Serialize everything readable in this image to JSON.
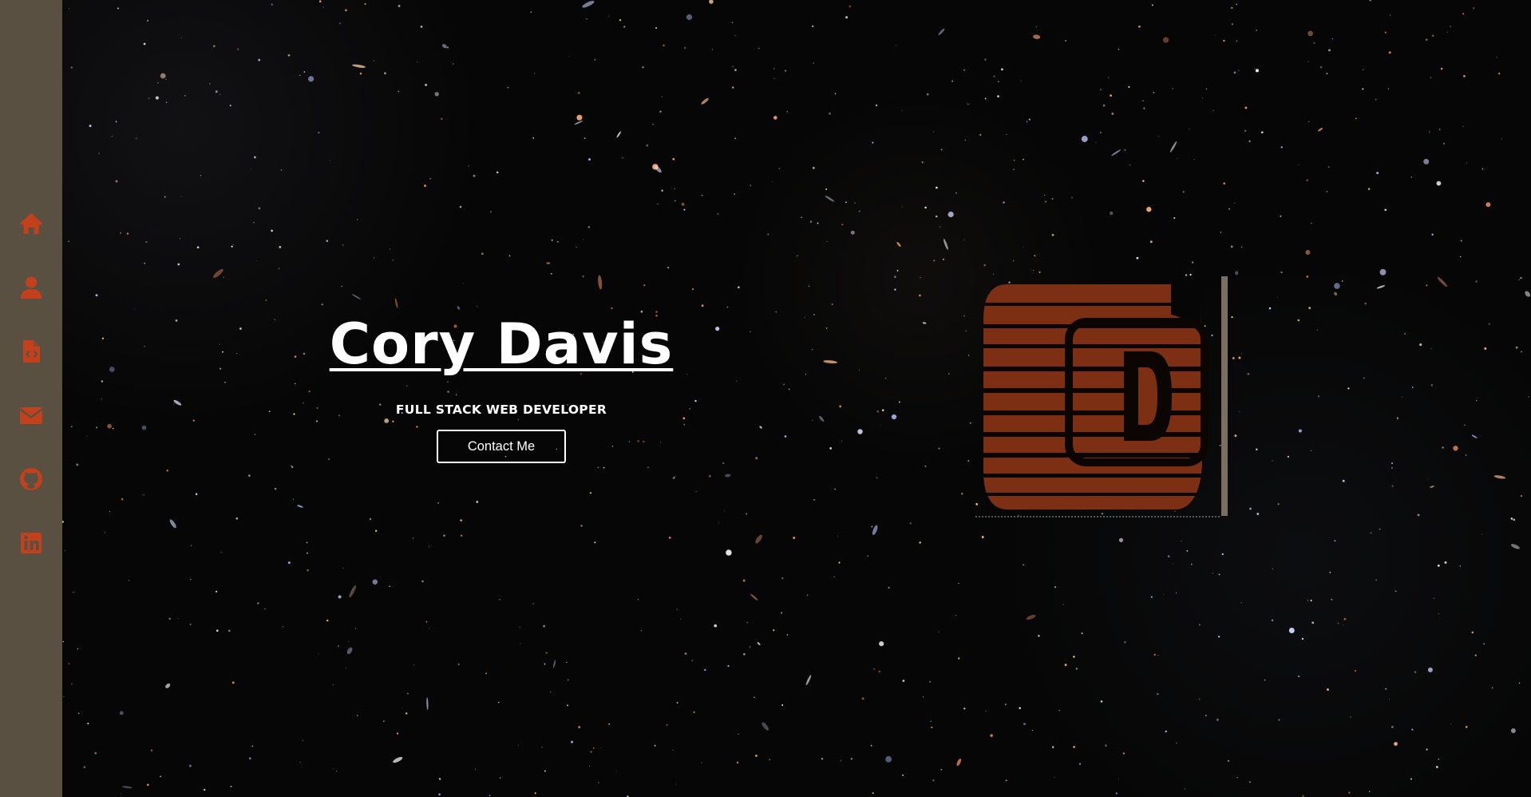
{
  "colors": {
    "sidebar_bg": "#5a5041",
    "icon_accent": "#c2411c",
    "logo_fill": "#7c2f12",
    "text": "#ffffff",
    "background": "#060606"
  },
  "sidebar": {
    "items": [
      {
        "icon": "home-icon",
        "name": "nav-home"
      },
      {
        "icon": "user-icon",
        "name": "nav-about"
      },
      {
        "icon": "file-code-icon",
        "name": "nav-portfolio"
      },
      {
        "icon": "envelope-icon",
        "name": "nav-contact"
      },
      {
        "icon": "github-icon",
        "name": "nav-github"
      },
      {
        "icon": "linkedin-icon",
        "name": "nav-linkedin"
      }
    ]
  },
  "hero": {
    "name": "Cory Davis",
    "subtitle": "FULL STACK WEB DEVELOPER",
    "contact_label": "Contact Me"
  },
  "logo": {
    "icon": "cd-logo-icon"
  }
}
